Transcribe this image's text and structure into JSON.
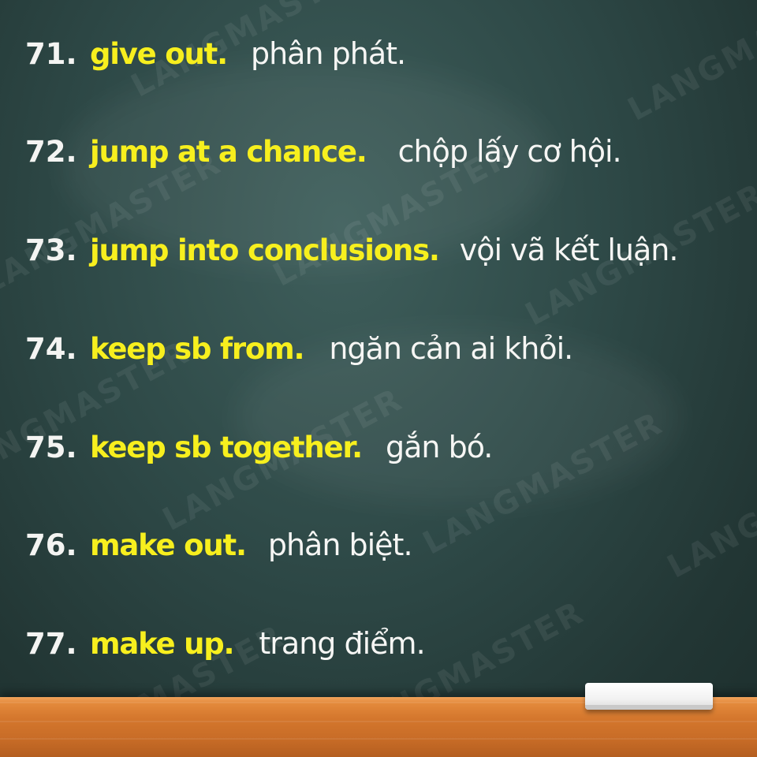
{
  "watermark": "LANGMASTER",
  "items": [
    {
      "number": "71.",
      "phrase": "give out.",
      "meaning": "phân phát."
    },
    {
      "number": "72.",
      "phrase": "jump at a chance.",
      "meaning": "chộp lấy cơ hội."
    },
    {
      "number": "73.",
      "phrase": "jump into conclusions.",
      "meaning": "vội vã kết luận."
    },
    {
      "number": "74.",
      "phrase": "keep sb from.",
      "meaning": "ngăn cản ai khỏi."
    },
    {
      "number": "75.",
      "phrase": "keep sb together.",
      "meaning": "gắn bó."
    },
    {
      "number": "76.",
      "phrase": "make out.",
      "meaning": "phân biệt."
    },
    {
      "number": "77.",
      "phrase": "make up.",
      "meaning": "trang điểm."
    }
  ],
  "colors": {
    "board": "#2e4947",
    "phrase": "#f7ef1e",
    "text": "#f6f6f4",
    "ledge": "#d4772d"
  }
}
